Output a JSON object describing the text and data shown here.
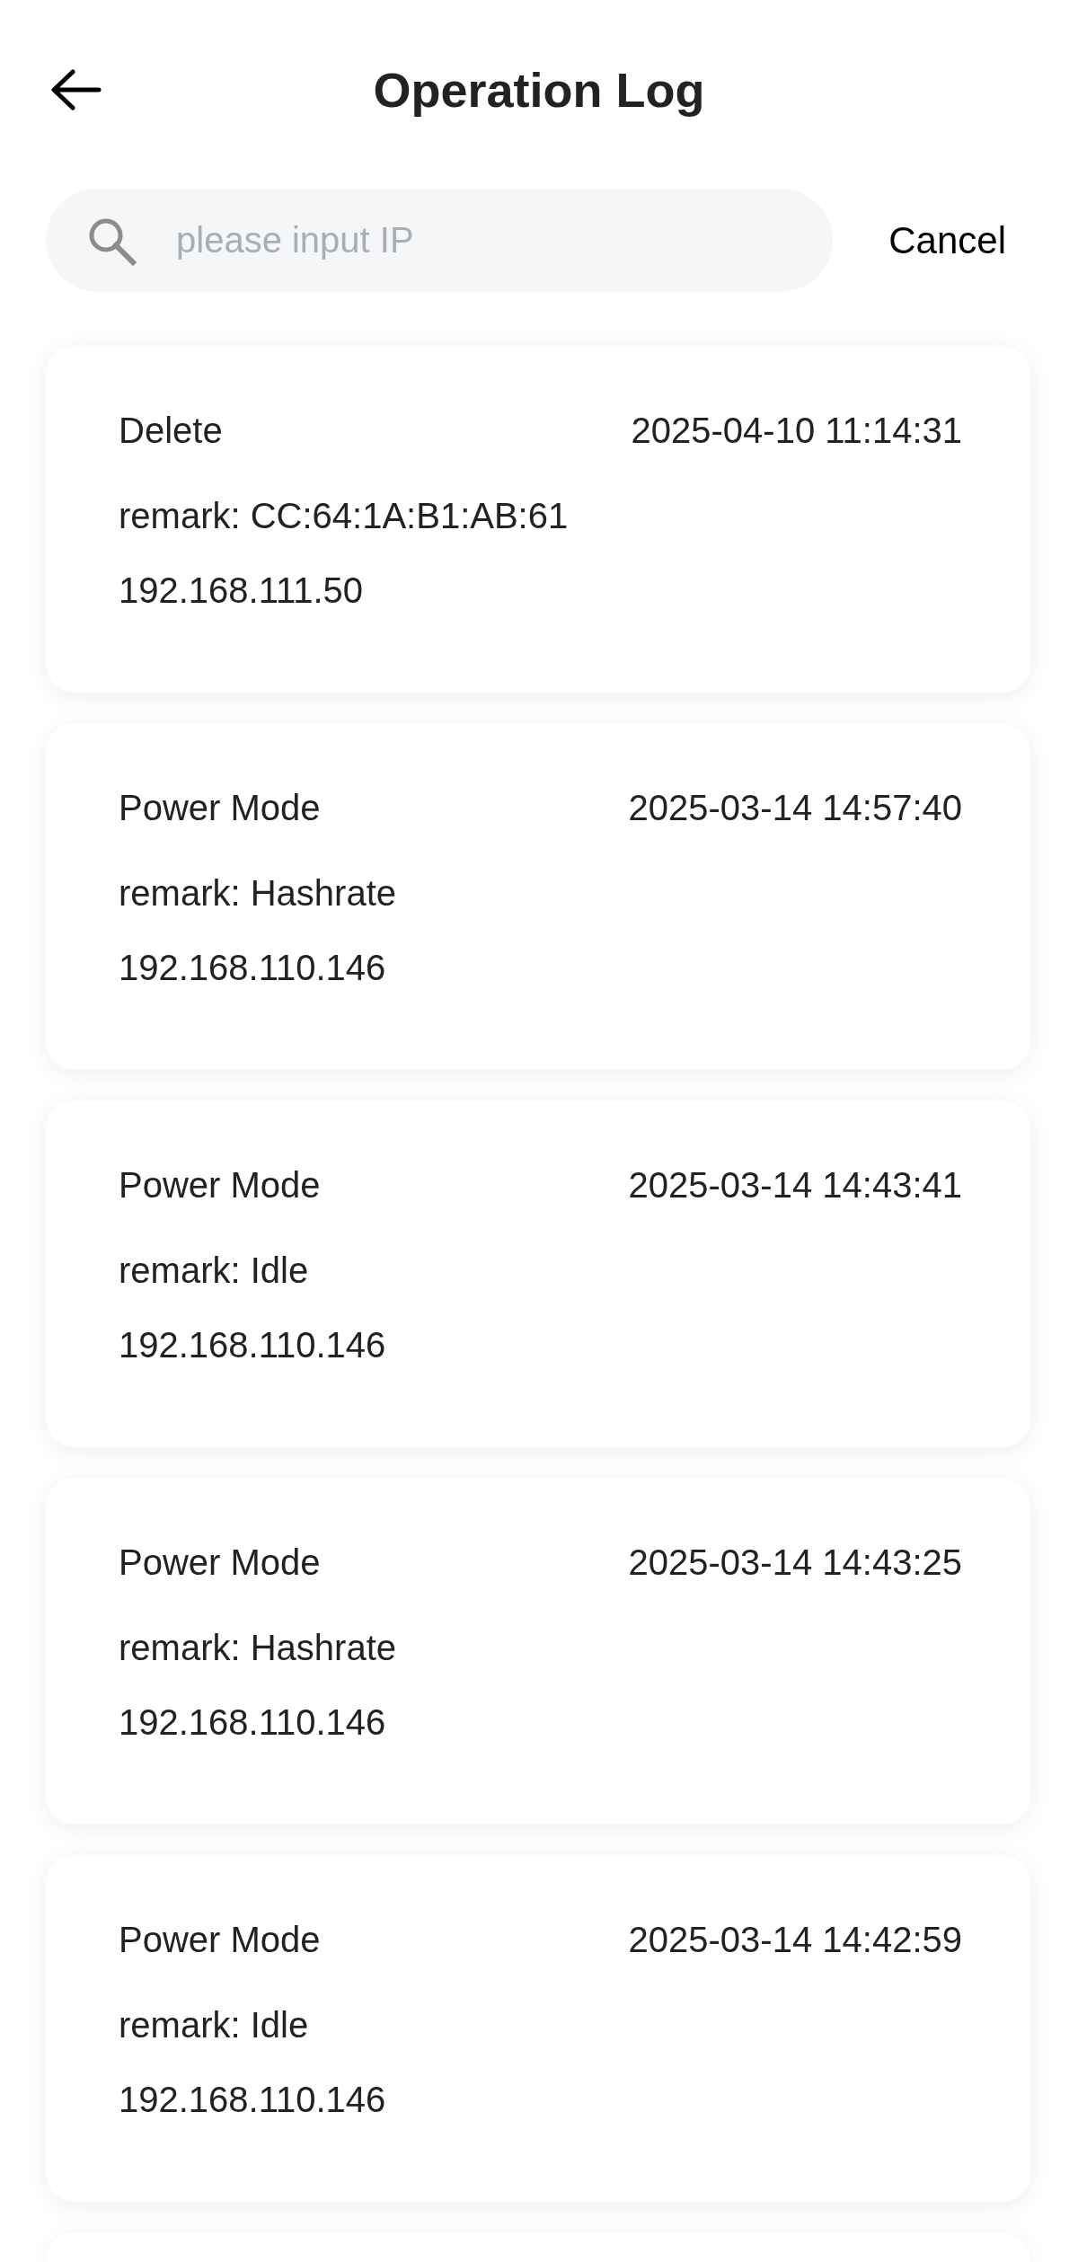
{
  "header": {
    "title": "Operation Log"
  },
  "search": {
    "placeholder": "please input IP",
    "action": "Cancel"
  },
  "entries": [
    {
      "action": "Delete",
      "time": "2025-04-10 11:14:31",
      "remark": "remark: CC:64:1A:B1:AB:61",
      "ip": "192.168.111.50"
    },
    {
      "action": "Power Mode",
      "time": "2025-03-14 14:57:40",
      "remark": "remark: Hashrate",
      "ip": "192.168.110.146"
    },
    {
      "action": "Power Mode",
      "time": "2025-03-14 14:43:41",
      "remark": "remark: Idle",
      "ip": "192.168.110.146"
    },
    {
      "action": "Power Mode",
      "time": "2025-03-14 14:43:25",
      "remark": "remark: Hashrate",
      "ip": "192.168.110.146"
    },
    {
      "action": "Power Mode",
      "time": "2025-03-14 14:42:59",
      "remark": "remark: Idle",
      "ip": "192.168.110.146"
    }
  ],
  "more_below": true
}
